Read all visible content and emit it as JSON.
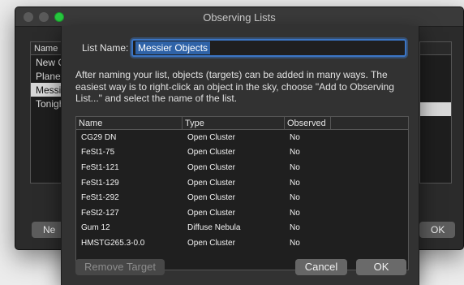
{
  "window": {
    "title": "Observing Lists"
  },
  "background": {
    "list_header": "Name",
    "items": [
      "New C",
      "Planet",
      "Messi",
      "Tonigh"
    ],
    "new_button": "Ne",
    "ok_button": "OK"
  },
  "sheet": {
    "name_label": "List Name:",
    "name_value": "Messier Objects",
    "description": "After naming your list, objects (targets) can be added in many ways. The easiest way is to right-click an object in the sky, choose \"Add to Observing List...\" and select the name of the list.",
    "columns": [
      "Name",
      "Type",
      "Observed"
    ],
    "rows": [
      [
        "CG29 DN",
        "Open Cluster",
        "No"
      ],
      [
        "FeSt1-75",
        "Open Cluster",
        "No"
      ],
      [
        "FeSt1-121",
        "Open Cluster",
        "No"
      ],
      [
        "FeSt1-129",
        "Open Cluster",
        "No"
      ],
      [
        "FeSt1-292",
        "Open Cluster",
        "No"
      ],
      [
        "FeSt2-127",
        "Open Cluster",
        "No"
      ],
      [
        "Gum 12",
        "Diffuse Nebula",
        "No"
      ],
      [
        "HMSTG265.3-0.0",
        "Open Cluster",
        "No"
      ]
    ],
    "remove_button": "Remove Target",
    "cancel_button": "Cancel",
    "ok_button": "OK"
  }
}
